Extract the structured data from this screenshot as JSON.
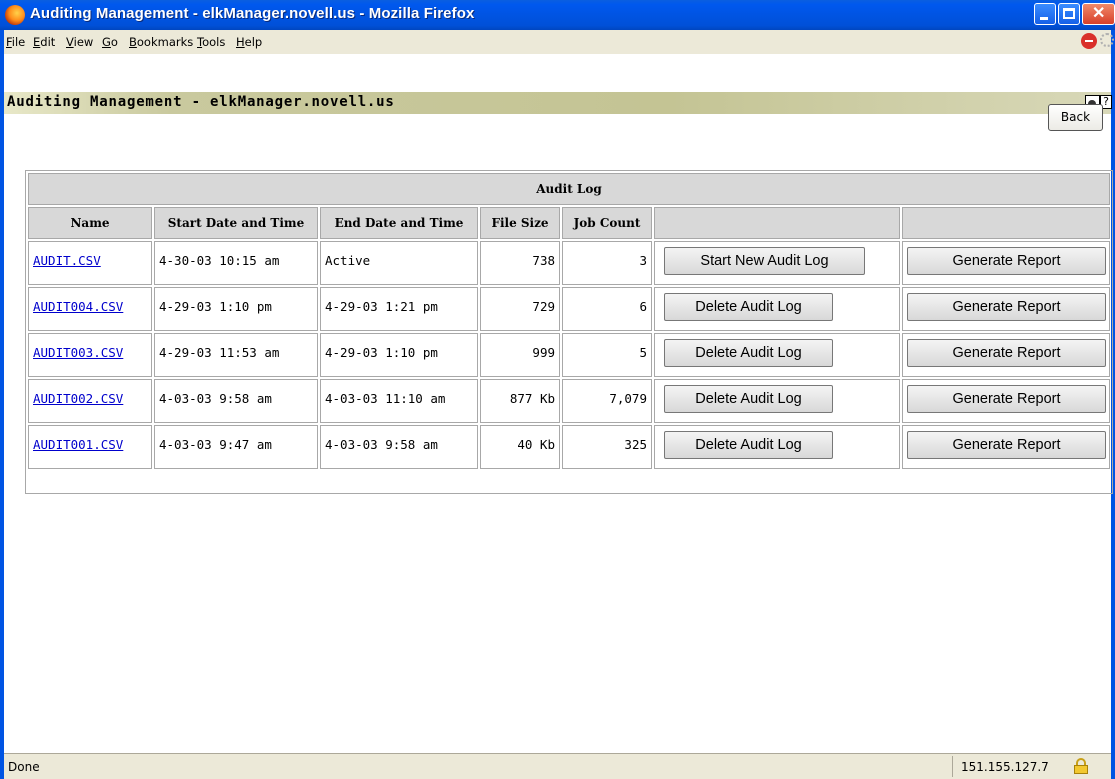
{
  "window": {
    "title": "Auditing Management - elkManager.novell.us - Mozilla Firefox"
  },
  "menu": [
    "File",
    "Edit",
    "View",
    "Go",
    "Bookmarks",
    "Tools",
    "Help"
  ],
  "page": {
    "header_title": "Auditing Management - elkManager.novell.us",
    "help_glyph": "?",
    "back_label": "Back"
  },
  "table": {
    "title": "Audit Log",
    "columns": [
      "Name",
      "Start Date and Time",
      "End Date and Time",
      "File Size",
      "Job Count"
    ],
    "rows": [
      {
        "name": "AUDIT.CSV",
        "start": "4-30-03 10:15 am",
        "end": "Active",
        "size": "738",
        "count": "3",
        "action": "Start New Audit Log",
        "report": "Generate Report"
      },
      {
        "name": "AUDIT004.CSV",
        "start": "4-29-03 1:10 pm",
        "end": "4-29-03 1:21 pm",
        "size": "729",
        "count": "6",
        "action": "Delete Audit Log",
        "report": "Generate Report"
      },
      {
        "name": "AUDIT003.CSV",
        "start": "4-29-03 11:53 am",
        "end": "4-29-03 1:10 pm",
        "size": "999",
        "count": "5",
        "action": "Delete Audit Log",
        "report": "Generate Report"
      },
      {
        "name": "AUDIT002.CSV",
        "start": "4-03-03 9:58 am",
        "end": "4-03-03 11:10 am",
        "size": "877 Kb",
        "count": "7,079",
        "action": "Delete Audit Log",
        "report": "Generate Report"
      },
      {
        "name": "AUDIT001.CSV",
        "start": "4-03-03 9:47 am",
        "end": "4-03-03 9:58 am",
        "size": "40 Kb",
        "count": "325",
        "action": "Delete Audit Log",
        "report": "Generate Report"
      }
    ]
  },
  "status": {
    "text": "Done",
    "ip": "151.155.127.7"
  }
}
